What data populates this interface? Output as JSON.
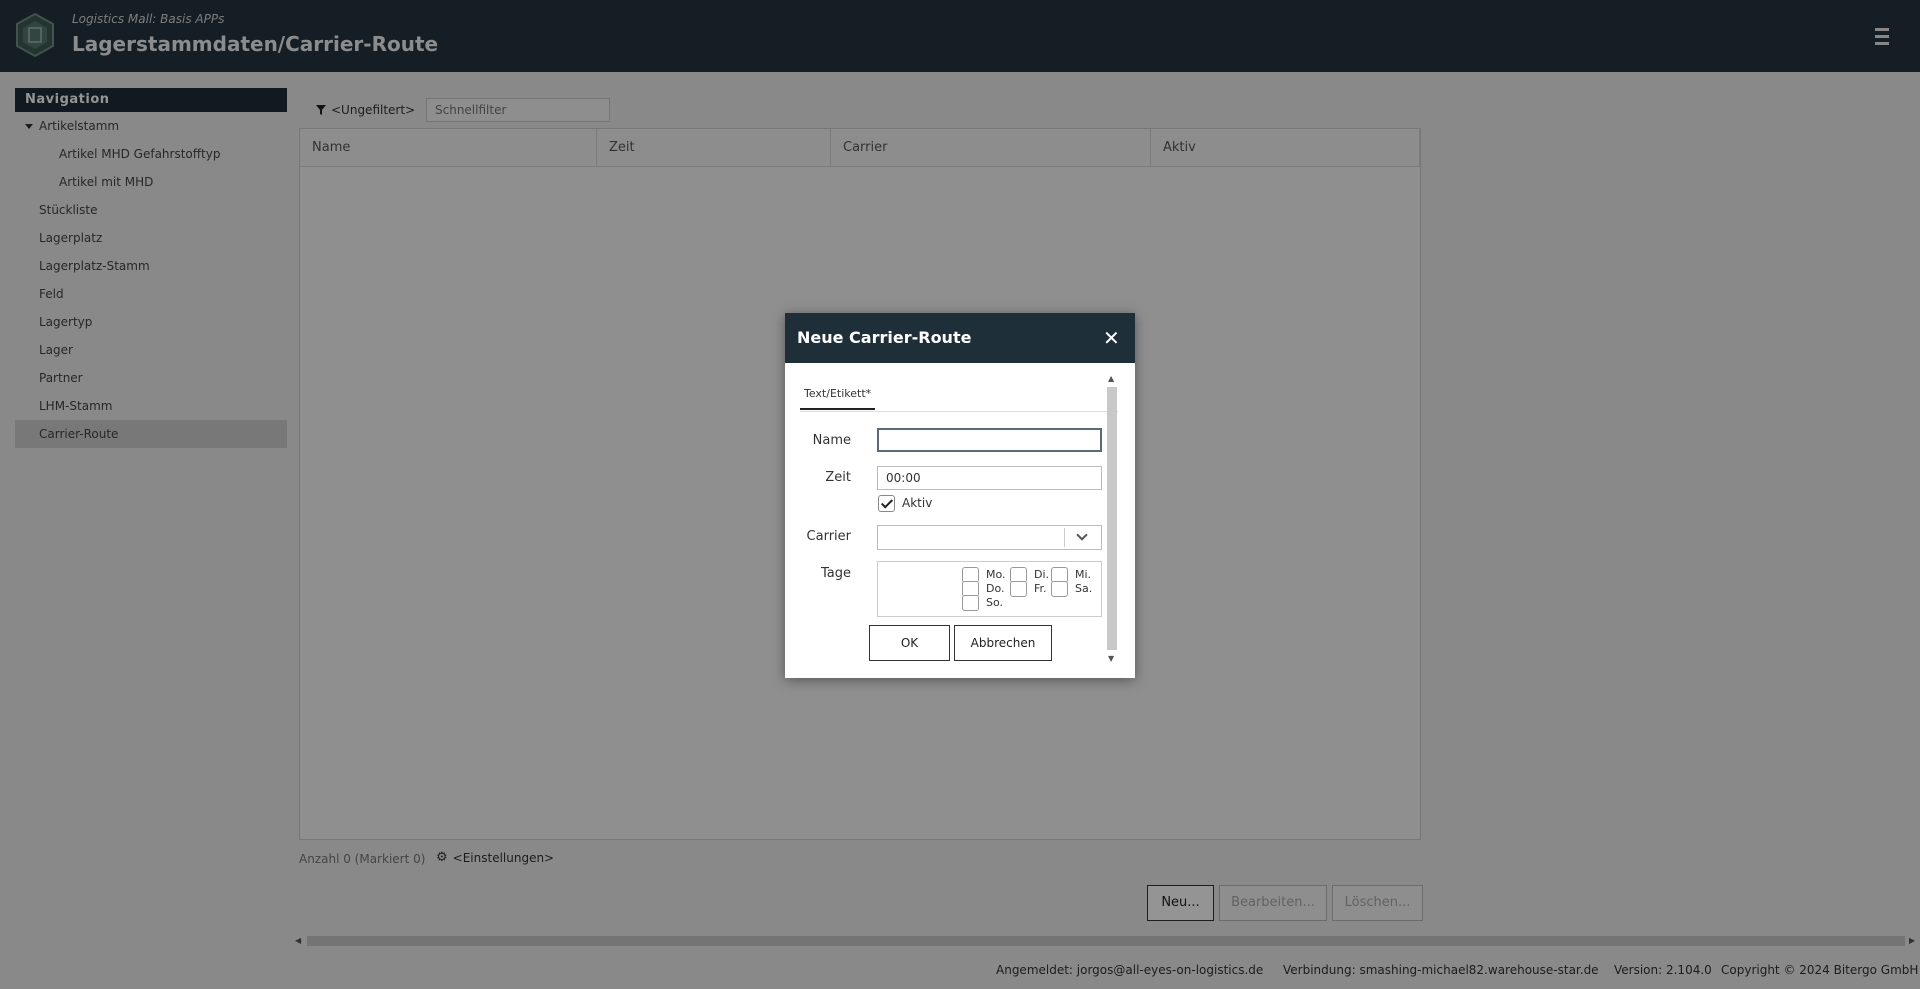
{
  "header": {
    "subtitle": "Logistics Mall: Basis APPs",
    "title": "Lagerstammdaten/Carrier-Route"
  },
  "nav": {
    "heading": "Navigation",
    "items": [
      {
        "label": "Artikelstamm"
      },
      {
        "label": "Artikel MHD Gefahrstofftyp"
      },
      {
        "label": "Artikel mit MHD"
      },
      {
        "label": "Stückliste"
      },
      {
        "label": "Lagerplatz"
      },
      {
        "label": "Lagerplatz-Stamm"
      },
      {
        "label": "Feld"
      },
      {
        "label": "Lagertyp"
      },
      {
        "label": "Lager"
      },
      {
        "label": "Partner"
      },
      {
        "label": "LHM-Stamm"
      },
      {
        "label": "Carrier-Route"
      }
    ]
  },
  "filter": {
    "label": "<Ungefiltert>",
    "placeholder": "Schnellfilter"
  },
  "grid": {
    "columns": [
      "Name",
      "Zeit",
      "Carrier",
      "Aktiv"
    ]
  },
  "status": {
    "count": "Anzahl 0 (Markiert 0)",
    "settings": "<Einstellungen>"
  },
  "actions": {
    "new": "Neu...",
    "edit": "Bearbeiten...",
    "delete": "Löschen..."
  },
  "footer": {
    "user": "Angemeldet: jorgos@all-eyes-on-logistics.de",
    "connection": "Verbindung: smashing-michael82.warehouse-star.de",
    "version": "Version: 2.104.0",
    "copyright": "Copyright © 2024 Bitergo GmbH"
  },
  "dialog": {
    "title": "Neue Carrier-Route",
    "tab": "Text/Etikett*",
    "name_label": "Name",
    "name_value": "",
    "zeit_label": "Zeit",
    "zeit_value": "00:00",
    "aktiv_label": "Aktiv",
    "aktiv_checked": true,
    "carrier_label": "Carrier",
    "carrier_value": "",
    "tage_label": "Tage",
    "days": {
      "mo": "Mo.",
      "di": "Di.",
      "mi": "Mi.",
      "do": "Do.",
      "fr": "Fr.",
      "sa": "Sa.",
      "so": "So."
    },
    "ok": "OK",
    "cancel": "Abbrechen"
  }
}
